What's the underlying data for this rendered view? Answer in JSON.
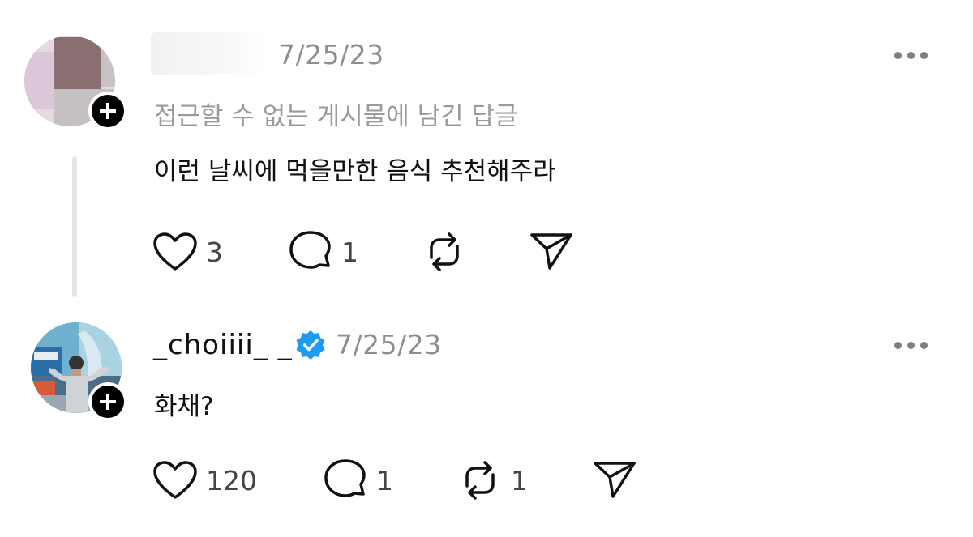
{
  "post": {
    "date": "7/25/23",
    "note": "접근할 수 없는 게시물에 남긴 답글",
    "text": "이런 날씨에 먹을만한 음식 추천해주라",
    "actions": {
      "like_count": "3",
      "reply_count": "1"
    }
  },
  "reply": {
    "username": "_choiiii_ _",
    "date": "7/25/23",
    "text": "화채?",
    "actions": {
      "like_count": "120",
      "reply_count": "1",
      "repost_count": "1"
    }
  },
  "icons": {
    "like": "heart-icon",
    "reply": "comment-bubble-icon",
    "repost": "repost-icon",
    "share": "send-icon",
    "more": "more-dots-icon",
    "follow": "plus-icon",
    "verified": "verified-badge-icon"
  },
  "colors": {
    "verified": "#1d9bf0",
    "muted": "#8e8e8e"
  }
}
